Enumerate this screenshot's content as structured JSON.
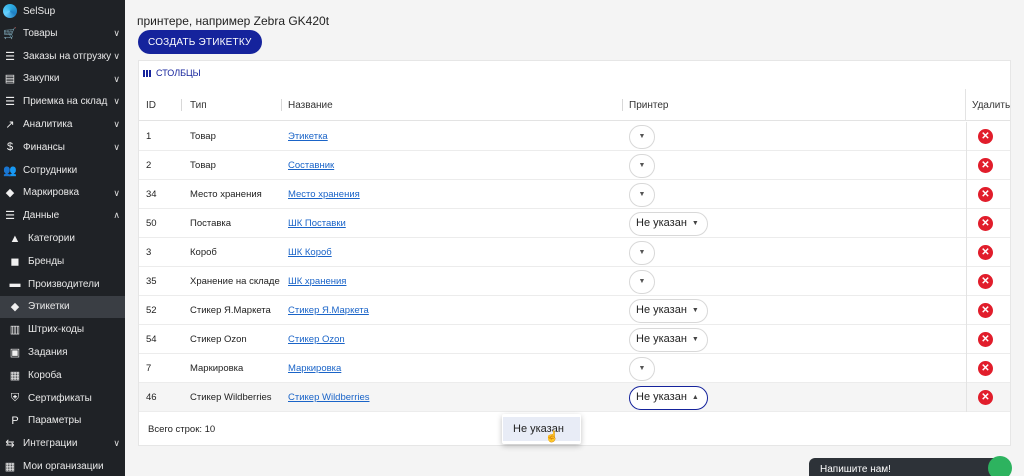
{
  "sidebar": {
    "brand": "SelSup",
    "items": [
      {
        "label": "Товары",
        "icon": "cart-icon",
        "chevron": "∨",
        "sub": false
      },
      {
        "label": "Заказы на отгрузку",
        "icon": "list-icon",
        "chevron": "∨",
        "sub": false
      },
      {
        "label": "Закупки",
        "icon": "store-icon",
        "chevron": "∨",
        "sub": false
      },
      {
        "label": "Приемка на склад",
        "icon": "list-icon",
        "chevron": "∨",
        "sub": false
      },
      {
        "label": "Аналитика",
        "icon": "trend-icon",
        "chevron": "∨",
        "sub": false
      },
      {
        "label": "Финансы",
        "icon": "dollar-icon",
        "chevron": "∨",
        "sub": false
      },
      {
        "label": "Сотрудники",
        "icon": "people-icon",
        "chevron": "",
        "sub": false
      },
      {
        "label": "Маркировка",
        "icon": "tag-icon",
        "chevron": "∨",
        "sub": false
      },
      {
        "label": "Данные",
        "icon": "list-icon",
        "chevron": "∧",
        "sub": false
      },
      {
        "label": "Категории",
        "icon": "category-icon",
        "chevron": "",
        "sub": true
      },
      {
        "label": "Бренды",
        "icon": "brand-icon",
        "chevron": "",
        "sub": true
      },
      {
        "label": "Производители",
        "icon": "factory-icon",
        "chevron": "",
        "sub": true
      },
      {
        "label": "Этикетки",
        "icon": "label-icon",
        "chevron": "",
        "sub": true,
        "active": true
      },
      {
        "label": "Штрих-коды",
        "icon": "barcode-icon",
        "chevron": "",
        "sub": true
      },
      {
        "label": "Задания",
        "icon": "task-icon",
        "chevron": "",
        "sub": true
      },
      {
        "label": "Короба",
        "icon": "box-icon",
        "chevron": "",
        "sub": true
      },
      {
        "label": "Сертификаты",
        "icon": "shield-icon",
        "chevron": "",
        "sub": true
      },
      {
        "label": "Параметры",
        "icon": "parameter-icon",
        "chevron": "",
        "sub": true
      },
      {
        "label": "Интеграции",
        "icon": "integration-icon",
        "chevron": "∨",
        "sub": false
      },
      {
        "label": "Мои организации",
        "icon": "organization-icon",
        "chevron": "",
        "sub": false
      }
    ]
  },
  "intro": {
    "line1": "принтере, например Zebra GK420t"
  },
  "actions": {
    "create_label": "СОЗДАТЬ ЭТИКЕТКУ",
    "columns_label": "СТОЛБЦЫ"
  },
  "table": {
    "headers": {
      "id": "ID",
      "type": "Тип",
      "name": "Название",
      "printer": "Принтер",
      "delete": "Удалить"
    },
    "rows": [
      {
        "id": "1",
        "type": "Товар",
        "name": "Этикетка",
        "printer": ""
      },
      {
        "id": "2",
        "type": "Товар",
        "name": "Составник",
        "printer": ""
      },
      {
        "id": "34",
        "type": "Место хранения",
        "name": "Место хранения",
        "printer": ""
      },
      {
        "id": "50",
        "type": "Поставка",
        "name": "ШК Поставки",
        "printer": "Не указан"
      },
      {
        "id": "3",
        "type": "Короб",
        "name": "ШК Короб",
        "printer": ""
      },
      {
        "id": "35",
        "type": "Хранение на складе",
        "name": "ШК хранения",
        "printer": ""
      },
      {
        "id": "52",
        "type": "Стикер Я.Маркета",
        "name": "Стикер Я.Маркета",
        "printer": "Не указан"
      },
      {
        "id": "54",
        "type": "Стикер Ozon",
        "name": "Стикер Ozon",
        "printer": "Не указан"
      },
      {
        "id": "7",
        "type": "Маркировка",
        "name": "Маркировка",
        "printer": ""
      },
      {
        "id": "46",
        "type": "Стикер Wildberries",
        "name": "Стикер Wildberries",
        "printer": "Не указан",
        "open": true
      }
    ],
    "footer": "Всего строк: 10"
  },
  "dropdown": {
    "options": [
      "Не указан"
    ]
  },
  "chat": {
    "label": "Напишите нам!"
  },
  "colors": {
    "sidebar_bg": "#1f2226",
    "accent": "#15239c",
    "link": "#1a64c8",
    "delete": "#e11d2b"
  }
}
